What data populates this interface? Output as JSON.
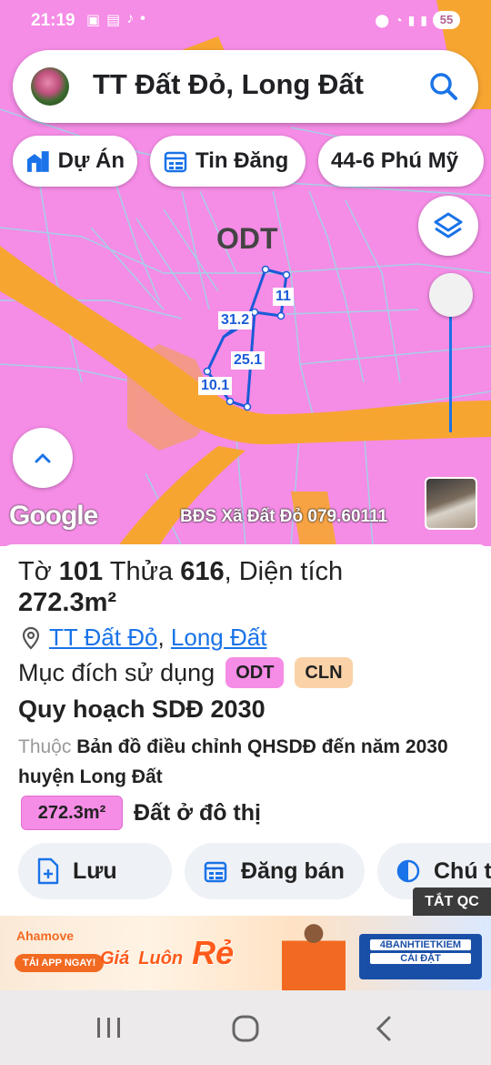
{
  "status": {
    "time": "21:19",
    "battery": "55"
  },
  "search": {
    "text": "TT Đất Đỏ, Long Đất"
  },
  "chips": {
    "du_an": "Dự Án",
    "tin_dang": "Tin Đăng",
    "address": "44-6 Phú Mỹ"
  },
  "map": {
    "zone_label": "ODT",
    "edges": [
      "11",
      "31.2",
      "25.1",
      "10.1"
    ],
    "logo": "Google",
    "watermark": "BĐS Xã Đất Đỏ 079.60111",
    "colors": {
      "residential": "#f58ce6",
      "road": "#f7a531",
      "salmon": "#f4988a",
      "parcel_outline": "#1a5bd8"
    }
  },
  "sheet": {
    "to_label": "Tờ",
    "to_value": "101",
    "thua_label": "Thửa",
    "thua_value": "616",
    "area_label": ", Diện tích",
    "area_value": "272.3m²",
    "location_1": "TT Đất Đỏ",
    "location_sep": ",",
    "location_2": "Long Đất",
    "purpose_label": "Mục đích sử dụng",
    "tags": [
      {
        "label": "ODT",
        "color": "#f58ce6"
      },
      {
        "label": "CLN",
        "color": "#fad2a8"
      }
    ],
    "plan_title": "Quy hoạch SDĐ 2030",
    "plan_prefix": "Thuộc",
    "plan_desc": "Bản đồ điều chỉnh QHSDĐ đến năm 2030 huyện Long Đất",
    "legend_area": "272.3m²",
    "legend_label": "Đất ở đô thị"
  },
  "actions": {
    "save": "Lưu",
    "post": "Đăng bán",
    "note": "Chú t"
  },
  "ad": {
    "close_label": "TẮT QC",
    "brand": "Ahamove",
    "cta": "TẢI APP NGAY!",
    "headline_1": "Giá",
    "headline_2": "Luôn",
    "headline_3": "Rẻ",
    "bank_name": "4BANHTIETKIEM",
    "bank_cta": "CÀI ĐẶT"
  }
}
